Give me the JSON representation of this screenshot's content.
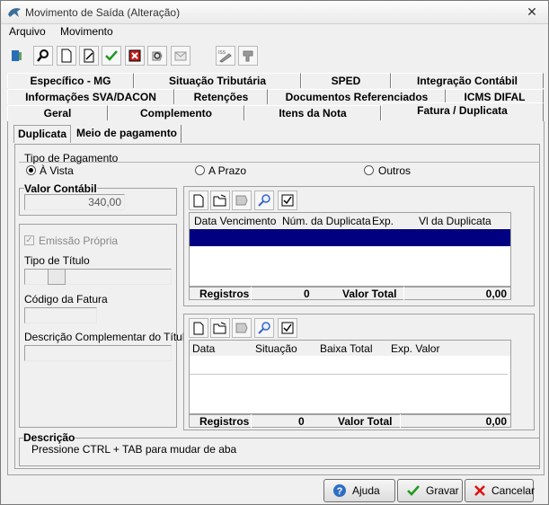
{
  "window": {
    "title": "Movimento de Saída (Alteração)"
  },
  "menu": [
    "Arquivo",
    "Movimento"
  ],
  "tabs": {
    "row1": [
      "Específico - MG",
      "Situação Tributária",
      "SPED",
      "Integração Contábil"
    ],
    "row2": [
      "Informações SVA/DACON",
      "Retenções",
      "Documentos Referenciados",
      "ICMS DIFAL"
    ],
    "row3": [
      "Geral",
      "Complemento",
      "Itens da Nota",
      "Fatura / Duplicata"
    ]
  },
  "subtabs": [
    "Duplicata",
    "Meio de pagamento"
  ],
  "tipo_pagamento": {
    "legend": "Tipo de Pagamento",
    "options": [
      "À Vista",
      "A Prazo",
      "Outros"
    ],
    "selected": "À Vista"
  },
  "valor_contabil": {
    "label": "Valor Contábil",
    "value": "340,00"
  },
  "emissao_propria": "Emissão Própria",
  "tipo_titulo": "Tipo de Título",
  "codigo_fatura": "Código da Fatura",
  "descricao_complementar": "Descrição Complementar do Título",
  "grid1": {
    "columns": [
      "Data Vencimento",
      "Núm. da Duplicata",
      "Exp.",
      "Vl da Duplicata"
    ],
    "footer": {
      "registros_label": "Registros",
      "registros": "0",
      "total_label": "Valor Total",
      "total": "0,00"
    }
  },
  "grid2": {
    "columns": [
      "Data",
      "Situação",
      "Baixa Total",
      "Exp. Valor"
    ],
    "footer": {
      "registros_label": "Registros",
      "registros": "0",
      "total_label": "Valor Total",
      "total": "0,00"
    }
  },
  "descricao": {
    "label": "Descrição",
    "text": "Pressione CTRL + TAB para  mudar de aba"
  },
  "buttons": {
    "ajuda": "Ajuda",
    "gravar": "Gravar",
    "cancelar": "Cancelar"
  }
}
